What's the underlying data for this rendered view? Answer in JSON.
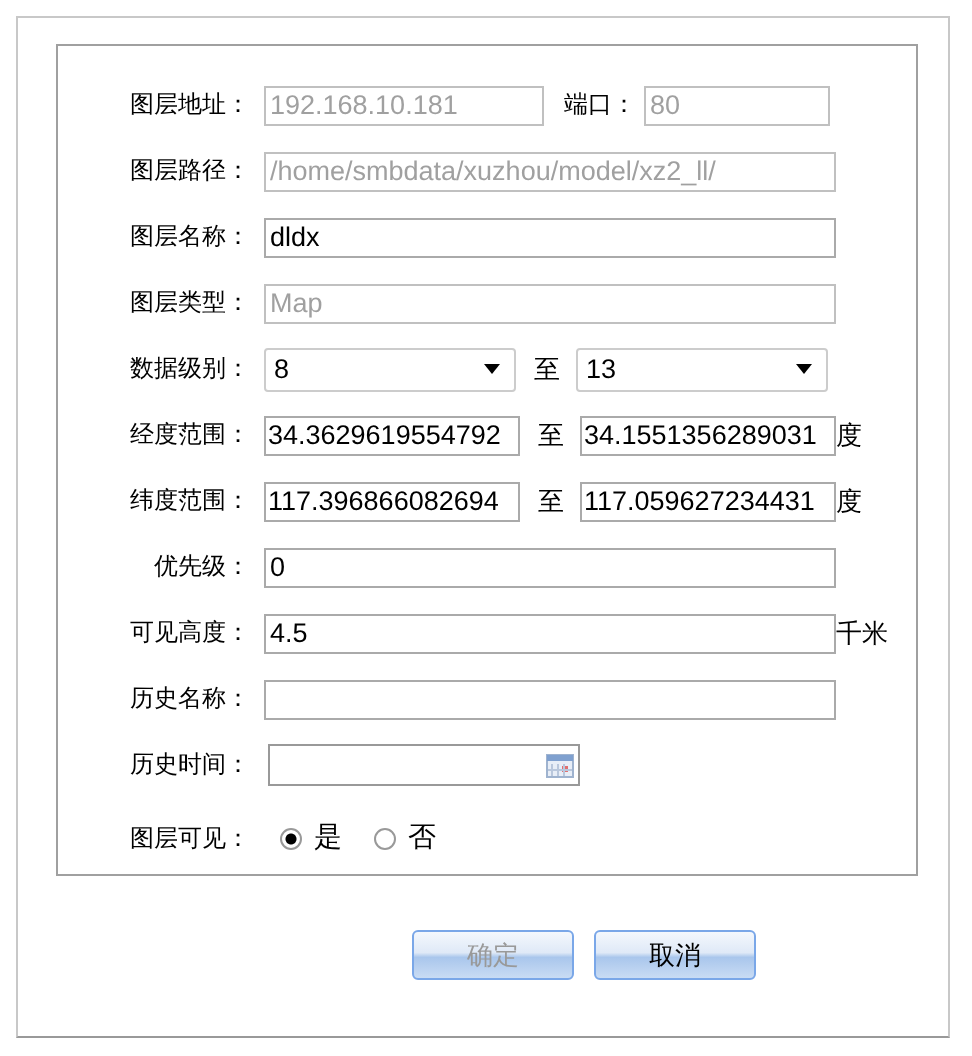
{
  "form": {
    "rows": [
      {
        "kind": "address",
        "label": "图层地址：",
        "value": "192.168.10.181",
        "disabled": true,
        "port_label": "端口：",
        "port_value": "80"
      },
      {
        "kind": "text",
        "label": "图层路径：",
        "value": "/home/smbdata/xuzhou/model/xz2_ll/",
        "disabled": true
      },
      {
        "kind": "text",
        "label": "图层名称：",
        "value": "dldx",
        "disabled": false
      },
      {
        "kind": "text",
        "label": "图层类型：",
        "value": "Map",
        "disabled": true
      },
      {
        "kind": "select_range",
        "label": "数据级别：",
        "from": "8",
        "sep": "至",
        "to": "13"
      },
      {
        "kind": "range",
        "label": "经度范围：",
        "from": "34.3629619554792",
        "sep": "至",
        "to": "34.1551356289031",
        "unit": "度"
      },
      {
        "kind": "range",
        "label": "纬度范围：",
        "from": "117.396866082694",
        "sep": "至",
        "to": "117.059627234431",
        "unit": "度"
      },
      {
        "kind": "text",
        "label": "优先级：",
        "value": "0",
        "disabled": false
      },
      {
        "kind": "text",
        "label": "可见高度：",
        "value": "4.5",
        "disabled": false,
        "unit": "千米"
      },
      {
        "kind": "text",
        "label": "历史名称：",
        "disabled": false
      },
      {
        "kind": "date",
        "label": "历史时间："
      },
      {
        "kind": "radio",
        "label": "图层可见：",
        "options": [
          {
            "label": "是",
            "selected": true
          },
          {
            "label": "否",
            "selected": false
          }
        ]
      }
    ]
  },
  "buttons": [
    {
      "label": "确定",
      "disabled": true
    },
    {
      "label": "取消",
      "disabled": false
    }
  ]
}
